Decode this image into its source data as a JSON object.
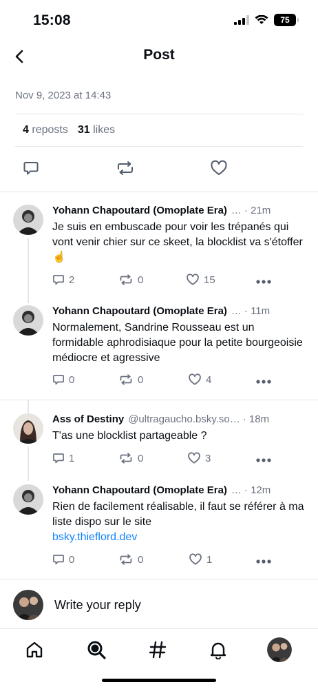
{
  "status_bar": {
    "time": "15:08",
    "battery": "75"
  },
  "nav": {
    "title": "Post"
  },
  "post": {
    "date": "Nov 9, 2023 at 14:43",
    "reposts_count": "4",
    "reposts_label": "reposts",
    "likes_count": "31",
    "likes_label": "likes"
  },
  "replies": [
    {
      "author": "Yohann Chapoutard (Omoplate Era)",
      "handle": "…",
      "time": "· 21m",
      "text": "Je suis en embuscade pour voir les trépanés qui vont venir chier sur ce skeet, la blocklist va s'étoffer ☝️",
      "link": "",
      "replies": "2",
      "reposts": "0",
      "likes": "15"
    },
    {
      "author": "Yohann Chapoutard (Omoplate Era)",
      "handle": "…",
      "time": "· 11m",
      "text": "Normalement, Sandrine Rousseau est un formidable aphrodisiaque pour la petite bourgeoisie médiocre et agressive",
      "link": "",
      "replies": "0",
      "reposts": "0",
      "likes": "4"
    },
    {
      "author": "Ass of Destiny",
      "handle": "@ultragaucho.bsky.so…",
      "time": "· 18m",
      "text": "T'as une blocklist partageable ?",
      "link": "",
      "replies": "1",
      "reposts": "0",
      "likes": "3"
    },
    {
      "author": "Yohann Chapoutard (Omoplate Era)",
      "handle": "…",
      "time": "· 12m",
      "text": "Rien de facilement réalisable, il faut se référer à ma liste dispo sur le site",
      "link": "bsky.thieflord.dev",
      "replies": "0",
      "reposts": "0",
      "likes": "1"
    }
  ],
  "reply_box": {
    "placeholder": "Write your reply"
  },
  "colors": {
    "accent": "#1083fe",
    "muted": "#6b7280",
    "divider": "#e3e6ea",
    "text": "#0b0f14"
  },
  "icons": {
    "back": "chevron-left-icon",
    "reply": "speech-bubble-icon",
    "repost": "repost-arrows-icon",
    "like": "heart-icon",
    "more": "ellipsis-icon",
    "home": "home-icon",
    "search": "search-icon",
    "feeds": "hashtag-icon",
    "notifications": "bell-icon"
  }
}
